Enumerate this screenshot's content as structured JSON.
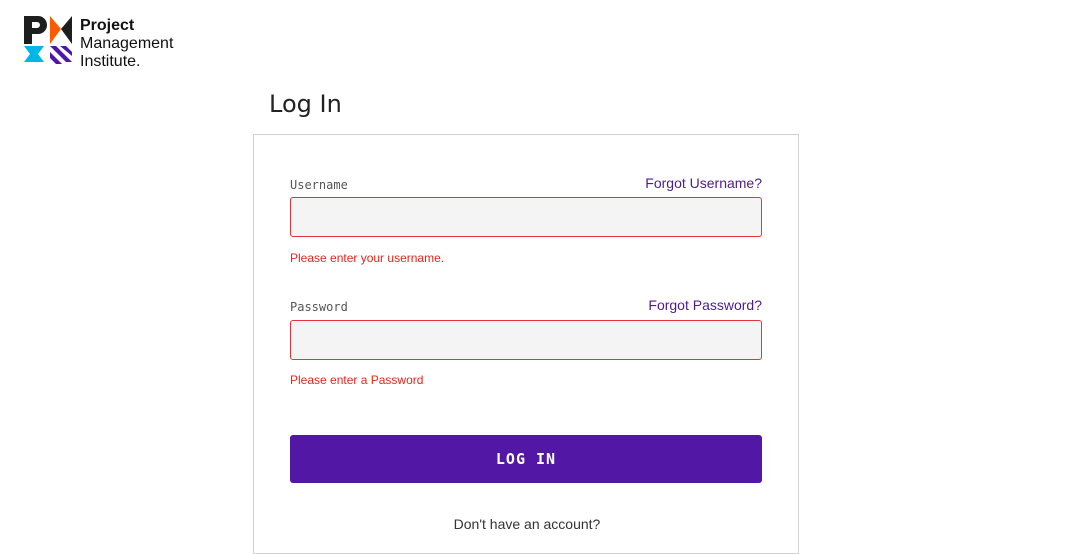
{
  "brand": {
    "line1": "Project",
    "line2": "Management",
    "line3": "Institute.",
    "colors": {
      "dark": "#1e1e1e",
      "orange": "#ff5a00",
      "blue": "#00b6e6",
      "purple": "#4f17a8"
    }
  },
  "page": {
    "title": "Log In"
  },
  "form": {
    "username": {
      "label": "Username",
      "forgot_link": "Forgot Username?",
      "value": "",
      "error": "Please enter your username."
    },
    "password": {
      "label": "Password",
      "forgot_link": "Forgot Password?",
      "value": "",
      "error": "Please enter a Password"
    },
    "submit_label": "LOG IN",
    "signup_prompt": "Don't have an account?"
  },
  "colors": {
    "accent": "#5317a6",
    "link": "#4b1d8e",
    "error": "#e8241d",
    "input_border_error": "#e3343a",
    "input_bg": "#f4f4f4"
  }
}
